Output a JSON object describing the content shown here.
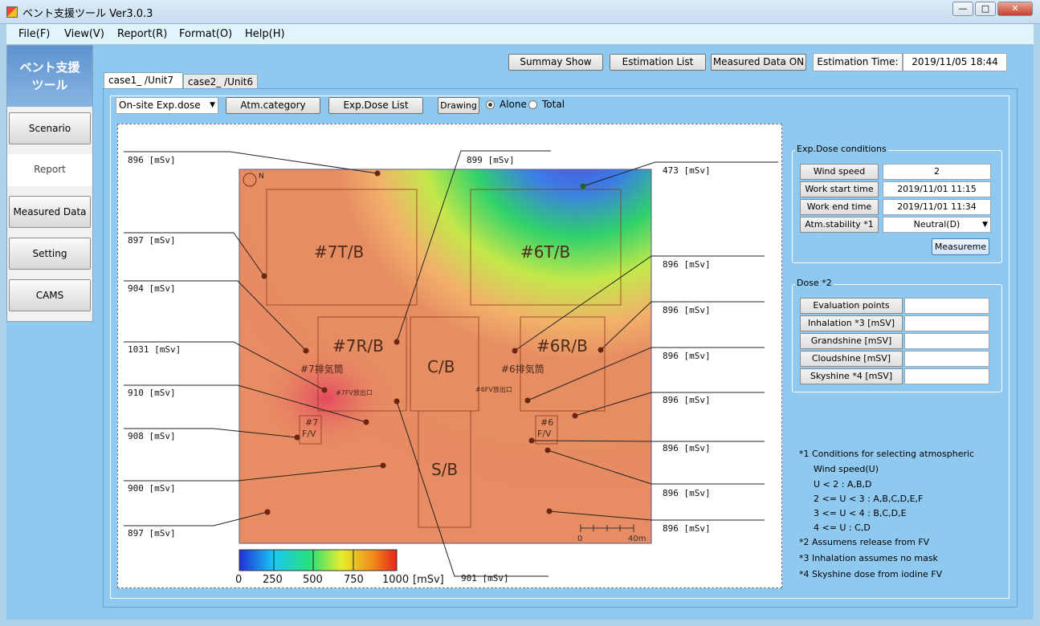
{
  "window": {
    "title": "ベント支援ツール Ver3.0.3",
    "min": "—",
    "max": "□",
    "close": "✕"
  },
  "menu": [
    "File(F)",
    "View(V)",
    "Report(R)",
    "Format(O)",
    "Help(H)"
  ],
  "sidebar": {
    "header_line1": "ベント支援",
    "header_line2": "ツール",
    "items": [
      "Scenario",
      "Report",
      "Measured Data",
      "Setting",
      "CAMS"
    ],
    "active": "Report"
  },
  "toolbar": {
    "summary": "Summay Show",
    "estimation_list": "Estimation List",
    "measured_on": "Measured Data ON",
    "est_time_label": "Estimation Time:",
    "est_time_value": "2019/11/05 18:44"
  },
  "tabs": [
    "case1_ /Unit7",
    "case2_ /Unit6"
  ],
  "controls": {
    "dose_select": "On-site Exp.dose",
    "atm_category": "Atm.category",
    "exp_dose_list": "Exp.Dose List",
    "drawing": "Drawing",
    "alone": "Alone",
    "total": "Total",
    "selected": "Alone"
  },
  "map": {
    "north": "N",
    "buildings": [
      "#7T/B",
      "#6T/B",
      "#7R/B",
      "C/B",
      "#6R/B",
      "S/B"
    ],
    "stack7": "#7排気筒",
    "stack6": "#6排気筒",
    "fv7_outlet": "#7FV放出口",
    "fv6_outlet": "#6FV放出口",
    "fv7": [
      "#7",
      "F/V"
    ],
    "fv6": [
      "#6",
      "F/V"
    ],
    "scale": [
      "0",
      "40m"
    ],
    "left_labels": [
      "896 [mSv]",
      "897 [mSv]",
      "904 [mSv]",
      "1031 [mSv]",
      "910 [mSv]",
      "908 [mSv]",
      "900 [mSv]",
      "897 [mSv]"
    ],
    "top_label": "899 [mSv]",
    "bottom_label": "901 [mSv]",
    "right_labels": [
      "473 [mSv]",
      "896 [mSv]",
      "896 [mSv]",
      "896 [mSv]",
      "896 [mSv]",
      "896 [mSv]",
      "896 [mSv]",
      "896 [mSv]"
    ],
    "colorbar": {
      "ticks": [
        "0",
        "250",
        "500",
        "750",
        "1000"
      ],
      "unit": "[mSv]",
      "colors": [
        "#1e2fd6",
        "#19c8f5",
        "#27e07a",
        "#e6ee2a",
        "#f08a1a",
        "#e8231a"
      ]
    }
  },
  "exp_conditions": {
    "title": "Exp.Dose conditions",
    "rows": [
      {
        "label": "Wind speed [m/s]",
        "value": "2"
      },
      {
        "label": "Work start time",
        "value": "2019/11/01 11:15"
      },
      {
        "label": "Work end time",
        "value": "2019/11/01 11:34"
      },
      {
        "label": "Atm.stability *1",
        "value": "Neutral(D)"
      }
    ],
    "measure_btn": "Measureme"
  },
  "dose": {
    "title": "Dose *2",
    "rows": [
      "Evaluation points",
      "Inhalation *3 [mSV]",
      "Grandshine  [mSV]",
      "Cloudshine  [mSV]",
      "Skyshine *4 [mSV]"
    ]
  },
  "notes": [
    "*1 Conditions for selecting atmospheric",
    "Wind speed(U)",
    "U < 2 :  A,B,D",
    "2 <= U < 3 :  A,B,C,D,E,F",
    "3 <= U < 4 :  B,C,D,E",
    "4 <= U :  C,D",
    "*2 Assumens release from FV",
    "*3 Inhalation assumes no mask",
    "*4 Skyshine dose from iodine FV"
  ]
}
